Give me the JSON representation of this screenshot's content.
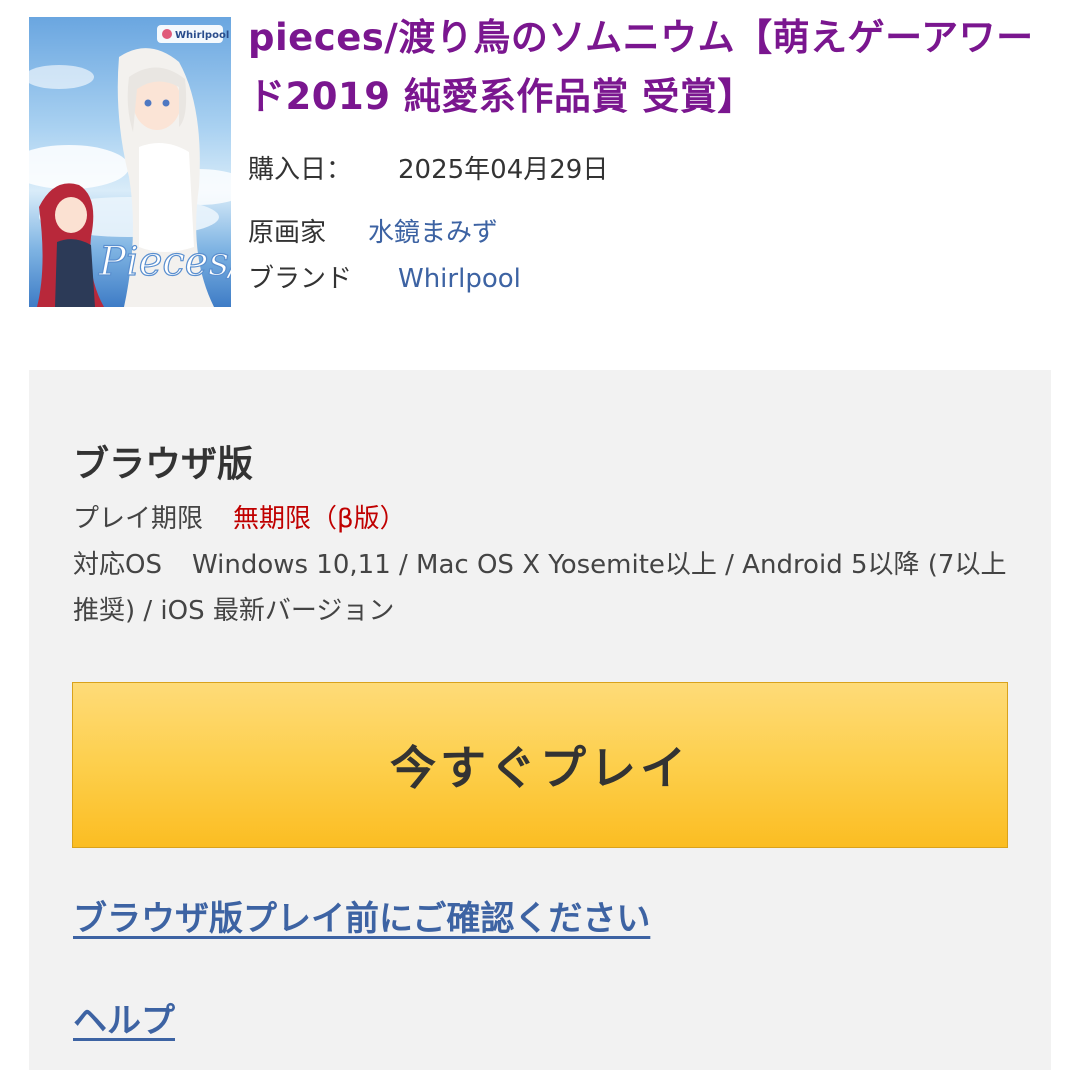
{
  "product": {
    "title": "pieces/渡り鳥のソムニウム【萌えゲーアワード2019 純愛系作品賞 受賞】",
    "cover_logo_text": "Pieces/",
    "cover_brand_badge": "Whirlpool",
    "purchase_date_label": "購入日：",
    "purchase_date": "2025年04月29日",
    "artist_label": "原画家",
    "artist": "水鏡まみず",
    "brand_label": "ブランド",
    "brand": "Whirlpool"
  },
  "browser_version": {
    "section_title": "ブラウザ版",
    "play_limit_label": "プレイ期限",
    "play_limit_value": "無期限（β版）",
    "os_label": "対応OS",
    "os_value": "Windows 10,11 / Mac OS X Yosemite以上 / Android 5以降 (7以上推奨) / iOS 最新バージョン",
    "play_button_label": "今すぐプレイ",
    "confirm_link": "ブラウザ版プレイ前にご確認ください",
    "help_link": "ヘルプ"
  },
  "colors": {
    "title": "#7a168f",
    "link": "#3d63a3",
    "limit_value": "#c00000",
    "button_top": "#fedb78",
    "button_bottom": "#fbbd22",
    "panel_bg": "#f2f2f2"
  }
}
